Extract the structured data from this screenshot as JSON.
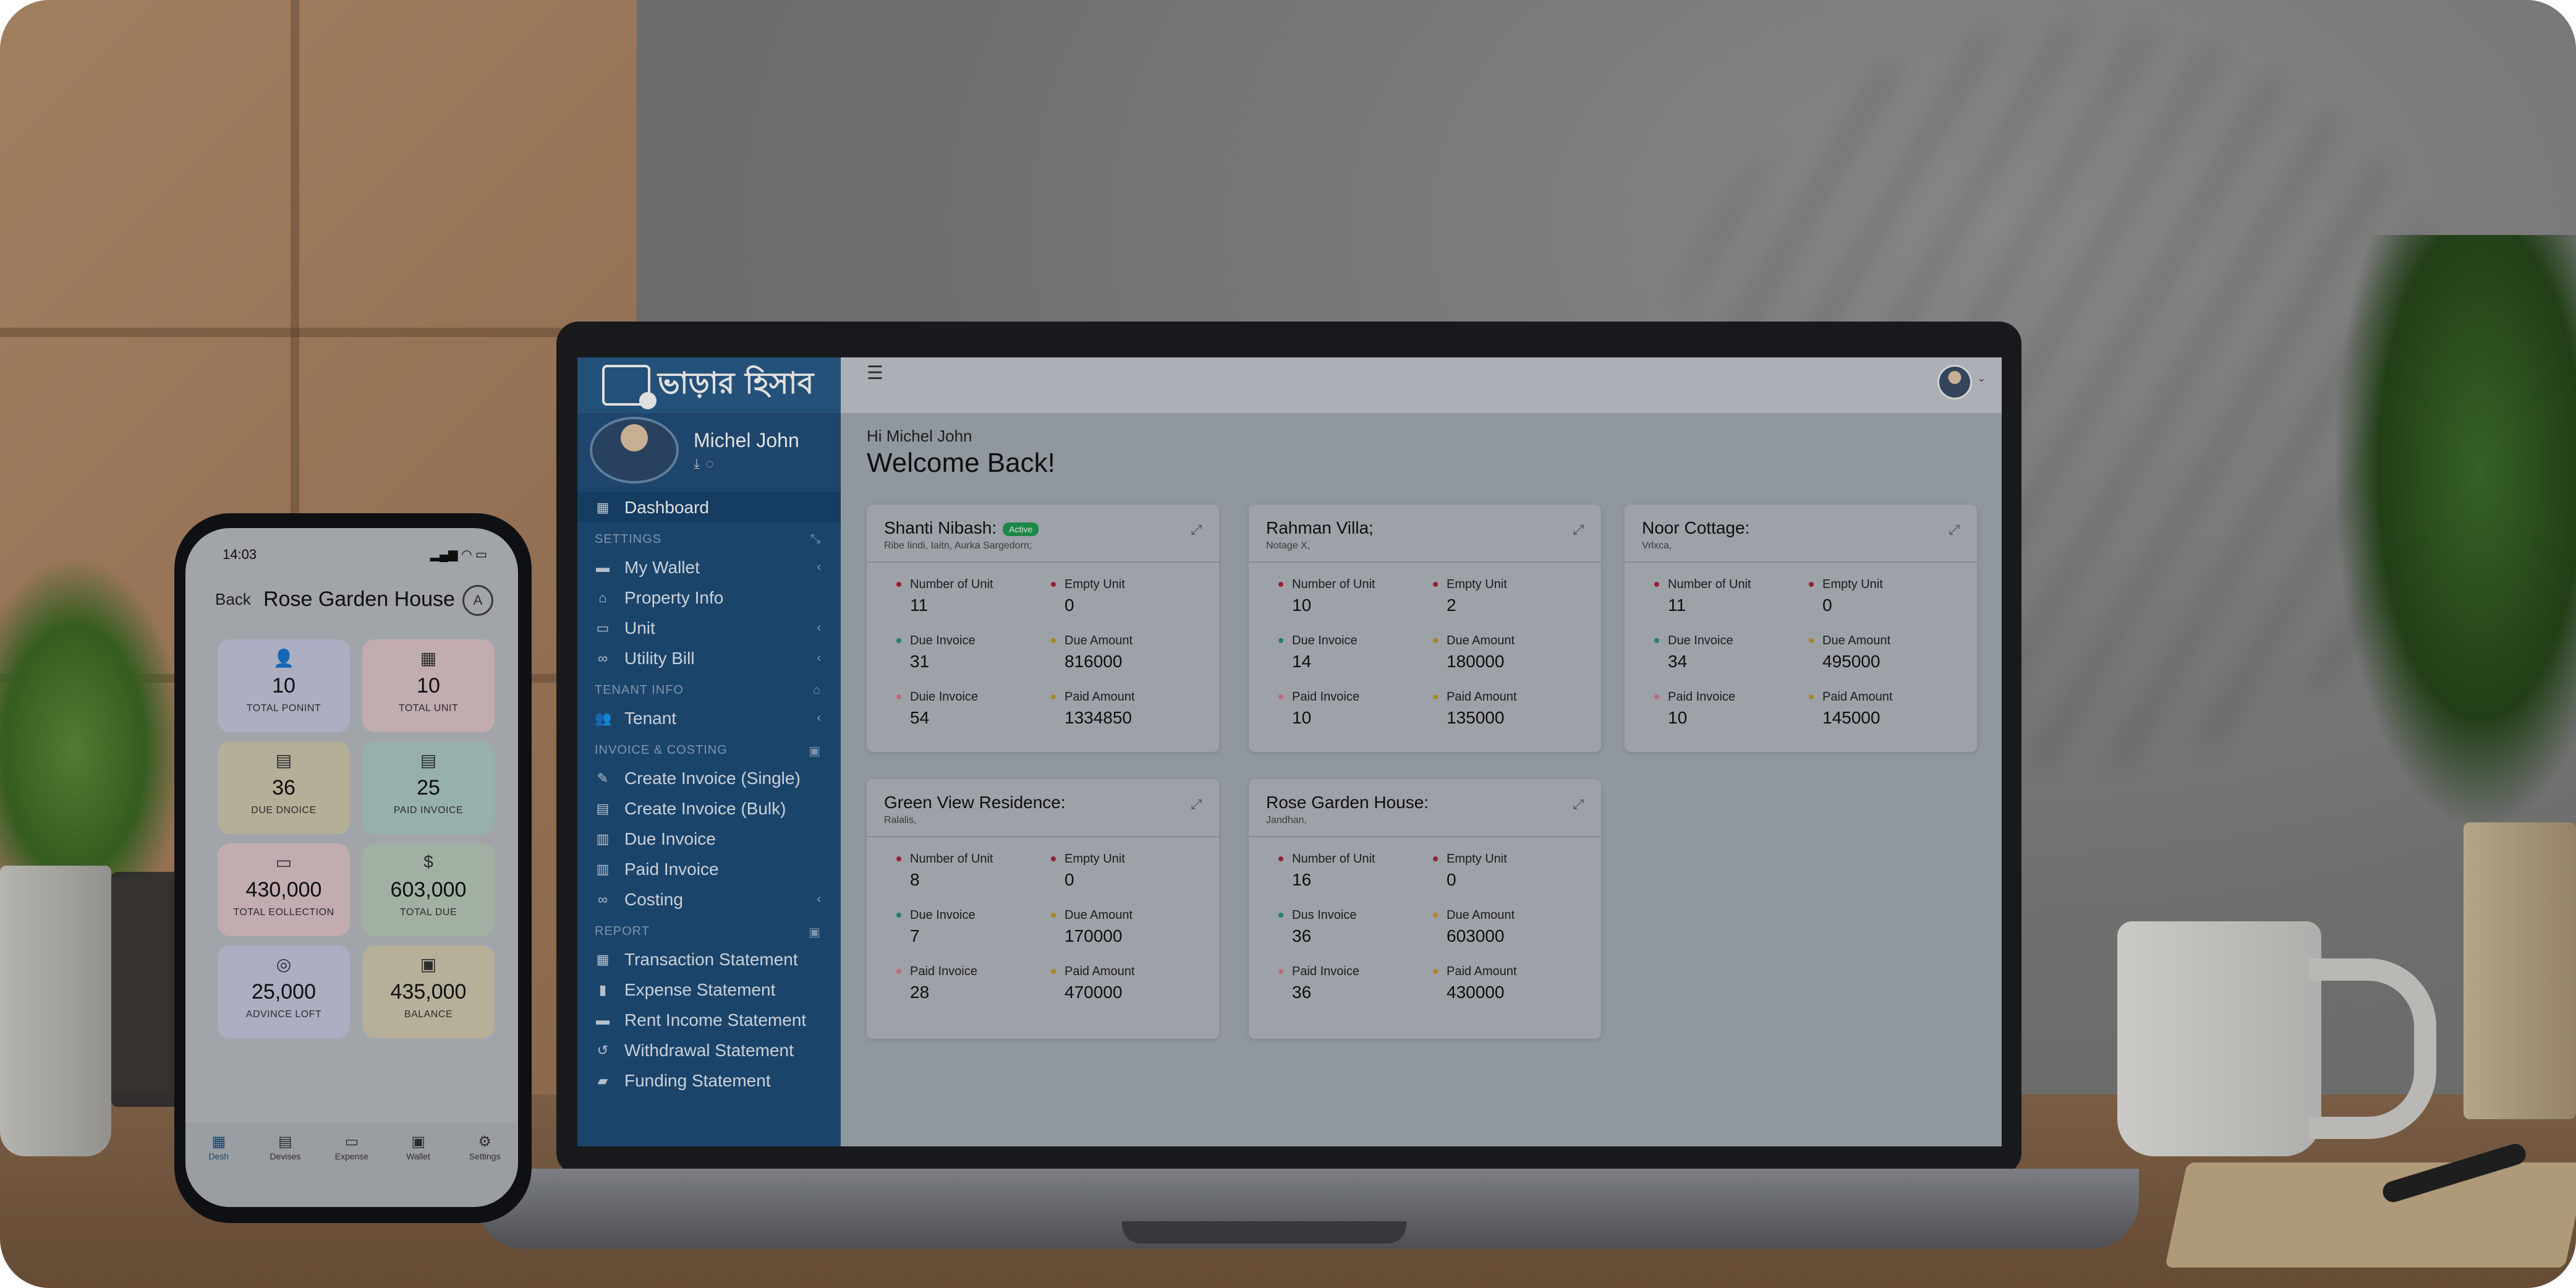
{
  "laptop_app": {
    "brand": "ভাড়ার হিসাব",
    "user": {
      "name": "Michel John"
    },
    "sidebar": {
      "dashboard": "Dashboard",
      "sections": {
        "settings": "SETTINGS",
        "tenant_info": "TENANT INFO",
        "invoice_costing": "INVOICE & COSTING",
        "report": "REPORT"
      },
      "items": {
        "my_wallet": "My Wallet",
        "property_info": "Property Info",
        "unit": "Unit",
        "utility_bill": "Utility Bill",
        "tenant": "Tenant",
        "create_invoice_single": "Create Invoice (Single)",
        "create_invoice_bulk": "Create Invoice (Bulk)",
        "due_invoice": "Due Invoice",
        "paid_invoice": "Paid Invoice",
        "costing": "Costing",
        "transaction_statement": "Transaction Statement",
        "expense_statement": "Expense Statement",
        "rent_income_statement": "Rent Income Statement",
        "withdrawal_statement": "Withdrawal Statement",
        "funding_statement": "Funding Statement"
      }
    },
    "main": {
      "greeting": "Hi Michel John",
      "welcome": "Welcome Back!",
      "cards": [
        {
          "title": "Shanti Nibash:",
          "badge": "Active",
          "subtitle": "Ribe Iindi, Iaitn, Aurka Sargedorn;",
          "stats": [
            {
              "label": "Number of Unit",
              "value": "11"
            },
            {
              "label": "Empty Unit",
              "value": "0"
            },
            {
              "label": "Due Invoice",
              "value": "31"
            },
            {
              "label": "Due Amount",
              "value": "816000"
            },
            {
              "label": "Duie Invoice",
              "value": "54"
            },
            {
              "label": "Paid Amount",
              "value": "1334850"
            }
          ]
        },
        {
          "title": "Rahman Villa;",
          "subtitle": "Notage X,",
          "stats": [
            {
              "label": "Number of Unit",
              "value": "10"
            },
            {
              "label": "Empty Unit",
              "value": "2"
            },
            {
              "label": "Due Invoice",
              "value": "14"
            },
            {
              "label": "Due Amount",
              "value": "180000"
            },
            {
              "label": "Paid Invoice",
              "value": "10"
            },
            {
              "label": "Paid Amount",
              "value": "135000"
            }
          ]
        },
        {
          "title": "Noor Cottage:",
          "subtitle": "Vrlxca,",
          "stats": [
            {
              "label": "Number of Unit",
              "value": "11"
            },
            {
              "label": "Empty Unit",
              "value": "0"
            },
            {
              "label": "Due Invoice",
              "value": "34"
            },
            {
              "label": "Due Amount",
              "value": "495000"
            },
            {
              "label": "Paid Invoice",
              "value": "10"
            },
            {
              "label": "Paid Amount",
              "value": "145000"
            }
          ]
        },
        {
          "title": "Green View Residence:",
          "subtitle": "Ralalis,",
          "stats": [
            {
              "label": "Number of Unit",
              "value": "8"
            },
            {
              "label": "Empty Unit",
              "value": "0"
            },
            {
              "label": "Due Invoice",
              "value": "7"
            },
            {
              "label": "Due Amount",
              "value": "170000"
            },
            {
              "label": "Paid Invoice",
              "value": "28"
            },
            {
              "label": "Paid Amount",
              "value": "470000"
            }
          ]
        },
        {
          "title": "Rose Garden House:",
          "subtitle": "Jandhan,",
          "stats": [
            {
              "label": "Number of Unit",
              "value": "16"
            },
            {
              "label": "Empty Unit",
              "value": "0"
            },
            {
              "label": "Dus Invoice",
              "value": "36"
            },
            {
              "label": "Due Amount",
              "value": "603000"
            },
            {
              "label": "Paid Invoice",
              "value": "36"
            },
            {
              "label": "Paid Amount",
              "value": "430000"
            }
          ]
        }
      ]
    }
  },
  "phone_app": {
    "time": "14:03",
    "back": "Back",
    "title": "Rose Garden House",
    "title_icon": "A",
    "tiles": [
      {
        "value": "10",
        "label": "TOTAL PONINT",
        "icon": "user-icon",
        "color": "#c4c8dd"
      },
      {
        "value": "10",
        "label": "TOTAL UNIT",
        "icon": "building-icon",
        "color": "#dcc4c8"
      },
      {
        "value": "36",
        "label": "DUE DNOICE",
        "icon": "document-icon",
        "color": "#cfc7ad"
      },
      {
        "value": "25",
        "label": "PAID INVOICE",
        "icon": "document-icon",
        "color": "#aec9c4"
      },
      {
        "value": "430,000",
        "label": "TOTAL EOLLECTION",
        "icon": "cash-icon",
        "color": "#dcc4c8"
      },
      {
        "value": "603,000",
        "label": "TOTAL DUE",
        "icon": "dollar-icon",
        "color": "#b8c9ba"
      },
      {
        "value": "25,000",
        "label": "ADVINCE LOFT",
        "icon": "coin-icon",
        "color": "#c4c8dd"
      },
      {
        "value": "435,000",
        "label": "BALANCE",
        "icon": "wallet-icon",
        "color": "#d0c8b0"
      }
    ],
    "tabs": [
      "Desh",
      "Devises",
      "Expense",
      "Wallet",
      "Settings"
    ]
  },
  "colors": {
    "sidebar": "#1f4e7a",
    "active_badge": "#1f9b53",
    "dot_red": "#b0233a",
    "dot_teal": "#2c8f83",
    "dot_gold": "#c39a2a",
    "dot_pink": "#d57a8a"
  }
}
